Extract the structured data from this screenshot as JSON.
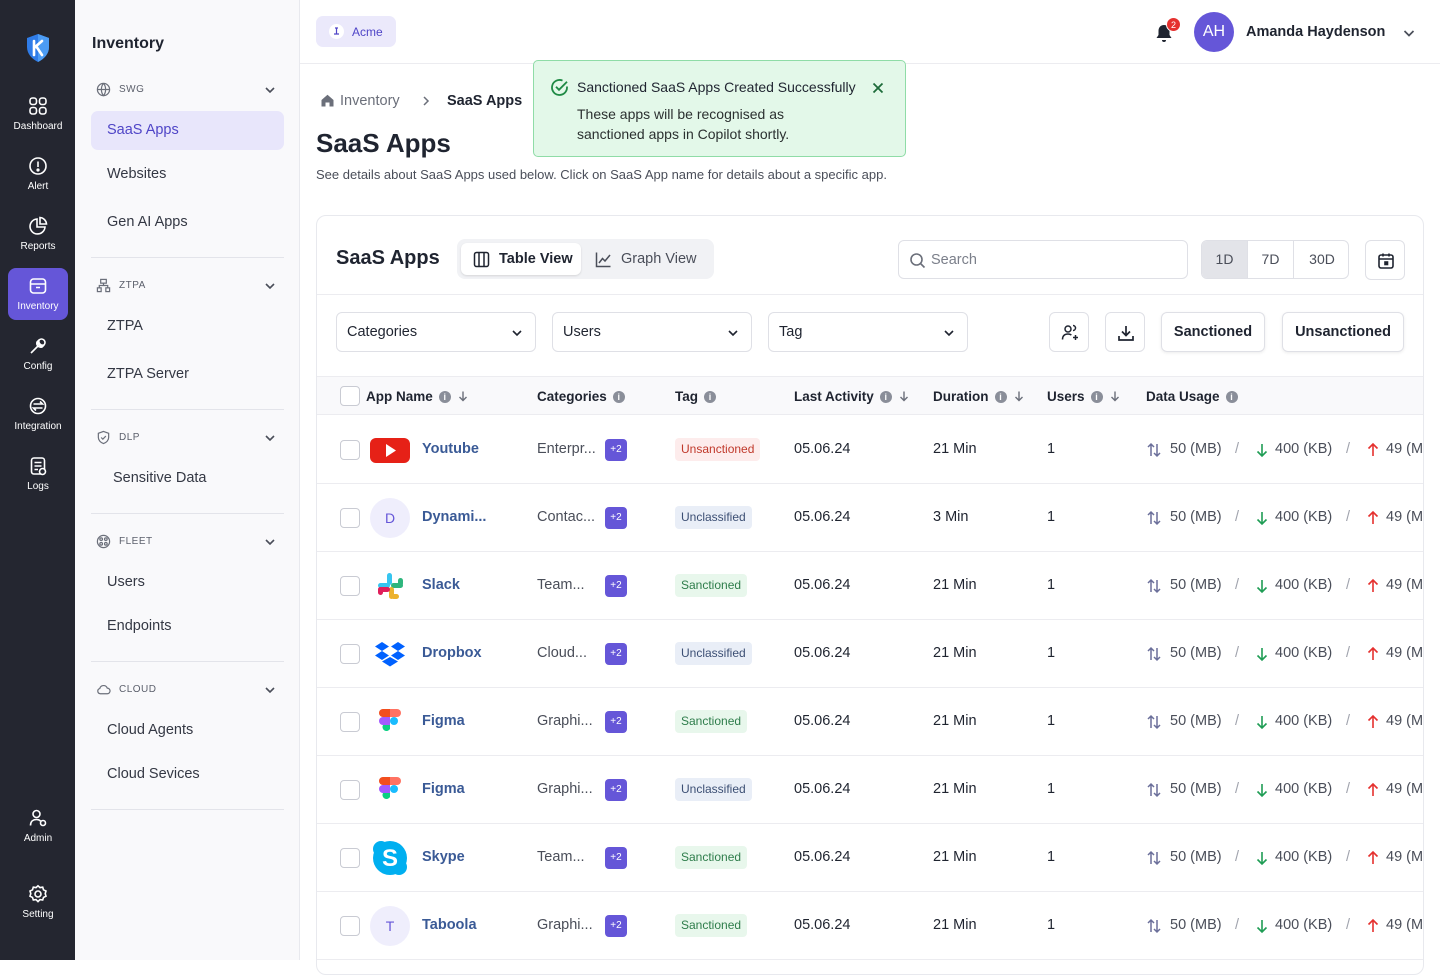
{
  "rail": [
    {
      "label": "Dashboard",
      "icon": "dashboard-icon",
      "active": false
    },
    {
      "label": "Alert",
      "icon": "alert-icon",
      "active": false
    },
    {
      "label": "Reports",
      "icon": "reports-icon",
      "active": false
    },
    {
      "label": "Inventory",
      "icon": "inventory-icon",
      "active": true
    },
    {
      "label": "Config",
      "icon": "config-icon",
      "active": false
    },
    {
      "label": "Integration",
      "icon": "integration-icon",
      "active": false
    },
    {
      "label": "Logs",
      "icon": "logs-icon",
      "active": false
    },
    {
      "label": "Admin",
      "icon": "admin-icon",
      "active": false
    },
    {
      "label": "Setting",
      "icon": "setting-icon",
      "active": false
    }
  ],
  "menu": {
    "title": "Inventory",
    "sections": [
      {
        "title": "SWG",
        "icon": "globe-icon",
        "items": [
          "SaaS Apps",
          "Websites",
          "Gen AI Apps"
        ],
        "active": "SaaS Apps"
      },
      {
        "title": "ZTPA",
        "icon": "network-icon",
        "items": [
          "ZTPA",
          "ZTPA Server"
        ]
      },
      {
        "title": "DLP",
        "icon": "shield-icon",
        "items": [
          "Sensitive Data"
        ]
      },
      {
        "title": "FLEET",
        "icon": "fleet-icon",
        "items": [
          "Users",
          "Endpoints"
        ]
      },
      {
        "title": "CLOUD",
        "icon": "cloud-icon",
        "items": [
          "Cloud Agents",
          "Cloud Sevices"
        ]
      }
    ]
  },
  "topbar": {
    "org": "Acme",
    "notifications": "2",
    "avatar_initials": "AH",
    "user_name": "Amanda Haydenson"
  },
  "breadcrumb": {
    "parent": "Inventory",
    "current": "SaaS Apps"
  },
  "page": {
    "title": "SaaS Apps",
    "subtitle": "See details about SaaS Apps used below. Click on SaaS App name for details about a specific app."
  },
  "toast": {
    "title": "Sanctioned SaaS Apps Created Successfully",
    "body": "These apps will be recognised as sanctioned apps in Copilot shortly."
  },
  "card": {
    "title": "SaaS Apps",
    "views": [
      "Table View",
      "Graph View"
    ],
    "active_view": "Table View",
    "search_placeholder": "Search",
    "ranges": [
      "1D",
      "7D",
      "30D"
    ],
    "active_range": "1D",
    "filters": [
      "Categories",
      "Users",
      "Tag"
    ],
    "sanctioned_label": "Sanctioned",
    "unsanctioned_label": "Unsanctioned"
  },
  "table": {
    "headers": {
      "app": "App Name",
      "categories": "Categories",
      "tag": "Tag",
      "last_activity": "Last Activity",
      "duration": "Duration",
      "users": "Users",
      "data_usage": "Data Usage"
    },
    "rows": [
      {
        "name": "Youtube",
        "logo": "youtube-logo",
        "category": "Enterpr...",
        "more": "+2",
        "tag": "Unsanctioned",
        "tag_kind": "unsanctioned",
        "last": "05.06.24",
        "duration": "21 Min",
        "users": "1",
        "total": "50 (MB)",
        "down": "400 (KB)",
        "up": "49 (M"
      },
      {
        "name": "Dynami...",
        "logo": "letter-D",
        "initial": "D",
        "category": "Contac...",
        "more": "+2",
        "tag": "Unclassified",
        "tag_kind": "unclassified",
        "last": "05.06.24",
        "duration": "3 Min",
        "users": "1",
        "total": "50 (MB)",
        "down": "400 (KB)",
        "up": "49 (M"
      },
      {
        "name": "Slack",
        "logo": "slack-logo",
        "category": "Team...",
        "more": "+2",
        "tag": "Sanctioned",
        "tag_kind": "sanctioned",
        "last": "05.06.24",
        "duration": "21 Min",
        "users": "1",
        "total": "50 (MB)",
        "down": "400 (KB)",
        "up": "49 (M"
      },
      {
        "name": "Dropbox",
        "logo": "dropbox-logo",
        "category": "Cloud...",
        "more": "+2",
        "tag": "Unclassified",
        "tag_kind": "unclassified",
        "last": "05.06.24",
        "duration": "21 Min",
        "users": "1",
        "total": "50 (MB)",
        "down": "400 (KB)",
        "up": "49 (M"
      },
      {
        "name": "Figma",
        "logo": "figma-logo",
        "category": "Graphi...",
        "more": "+2",
        "tag": "Sanctioned",
        "tag_kind": "sanctioned",
        "last": "05.06.24",
        "duration": "21 Min",
        "users": "1",
        "total": "50 (MB)",
        "down": "400 (KB)",
        "up": "49 (M"
      },
      {
        "name": "Figma",
        "logo": "figma-logo",
        "category": "Graphi...",
        "more": "+2",
        "tag": "Unclassified",
        "tag_kind": "unclassified",
        "last": "05.06.24",
        "duration": "21 Min",
        "users": "1",
        "total": "50 (MB)",
        "down": "400 (KB)",
        "up": "49 (M"
      },
      {
        "name": "Skype",
        "logo": "skype-logo",
        "category": "Team...",
        "more": "+2",
        "tag": "Sanctioned",
        "tag_kind": "sanctioned",
        "last": "05.06.24",
        "duration": "21 Min",
        "users": "1",
        "total": "50 (MB)",
        "down": "400 (KB)",
        "up": "49 (M"
      },
      {
        "name": "Taboola",
        "logo": "letter-T",
        "initial": "T",
        "category": "Graphi...",
        "more": "+2",
        "tag": "Sanctioned",
        "tag_kind": "sanctioned",
        "last": "05.06.24",
        "duration": "21 Min",
        "users": "1",
        "total": "50 (MB)",
        "down": "400 (KB)",
        "up": "49 (M"
      }
    ]
  },
  "colors": {
    "accent": "#6556d8",
    "rail_bg": "#242630",
    "toast_bg": "#e3f8e9",
    "toast_border": "#8fdca7"
  }
}
